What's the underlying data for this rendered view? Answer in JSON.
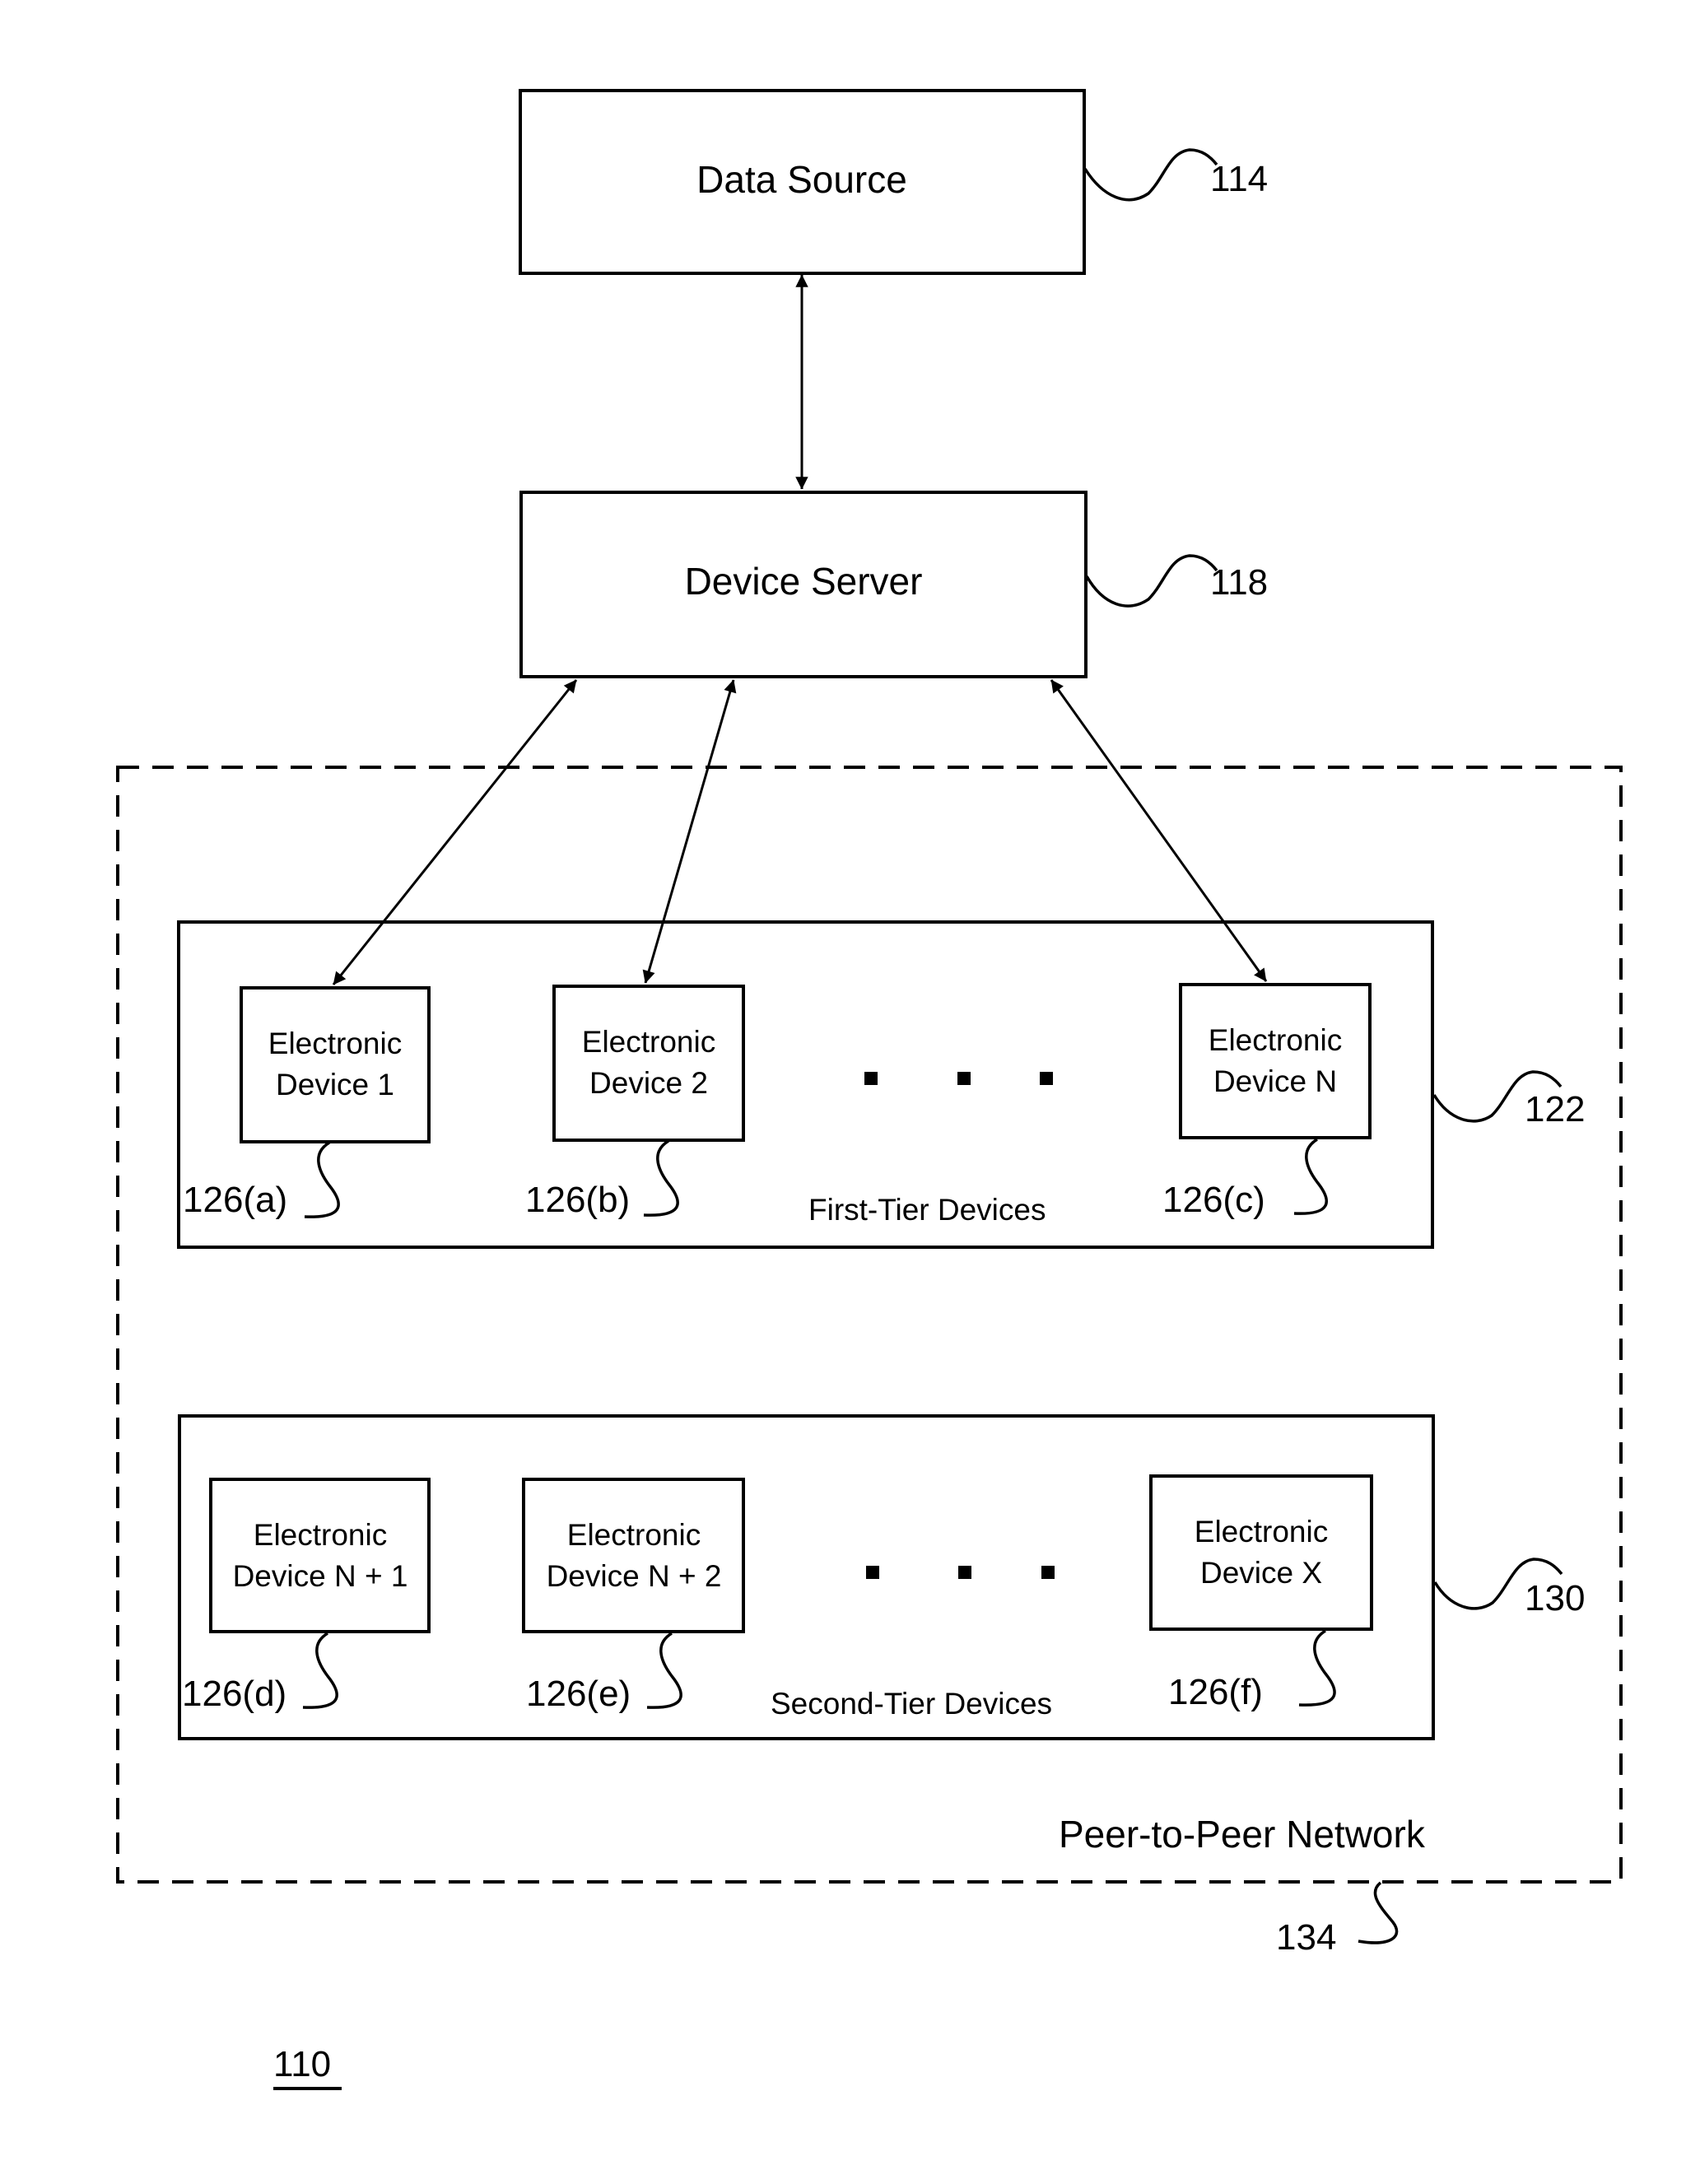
{
  "figure": {
    "number": "110",
    "data_source": {
      "label": "Data Source",
      "ref": "114"
    },
    "device_server": {
      "label": "Device Server",
      "ref": "118"
    },
    "network": {
      "label": "Peer-to-Peer Network",
      "ref": "134"
    },
    "first_tier": {
      "label": "First-Tier Devices",
      "ref": "122",
      "devices": [
        {
          "line1": "Electronic",
          "line2": "Device 1",
          "ref": "126(a)"
        },
        {
          "line1": "Electronic",
          "line2": "Device 2",
          "ref": "126(b)"
        },
        {
          "line1": "Electronic",
          "line2": "Device N",
          "ref": "126(c)"
        }
      ],
      "ellipsis": "..."
    },
    "second_tier": {
      "label": "Second-Tier Devices",
      "ref": "130",
      "devices": [
        {
          "line1": "Electronic",
          "line2": "Device N + 1",
          "ref": "126(d)"
        },
        {
          "line1": "Electronic",
          "line2": "Device N + 2",
          "ref": "126(e)"
        },
        {
          "line1": "Electronic",
          "line2": "Device X",
          "ref": "126(f)"
        }
      ],
      "ellipsis": "..."
    },
    "connections": [
      {
        "from": "Data Source",
        "to": "Device Server",
        "type": "bidirectional"
      },
      {
        "from": "Device Server",
        "to": "Electronic Device 1",
        "type": "bidirectional"
      },
      {
        "from": "Device Server",
        "to": "Electronic Device 2",
        "type": "bidirectional"
      },
      {
        "from": "Device Server",
        "to": "Electronic Device N",
        "type": "bidirectional"
      }
    ]
  }
}
